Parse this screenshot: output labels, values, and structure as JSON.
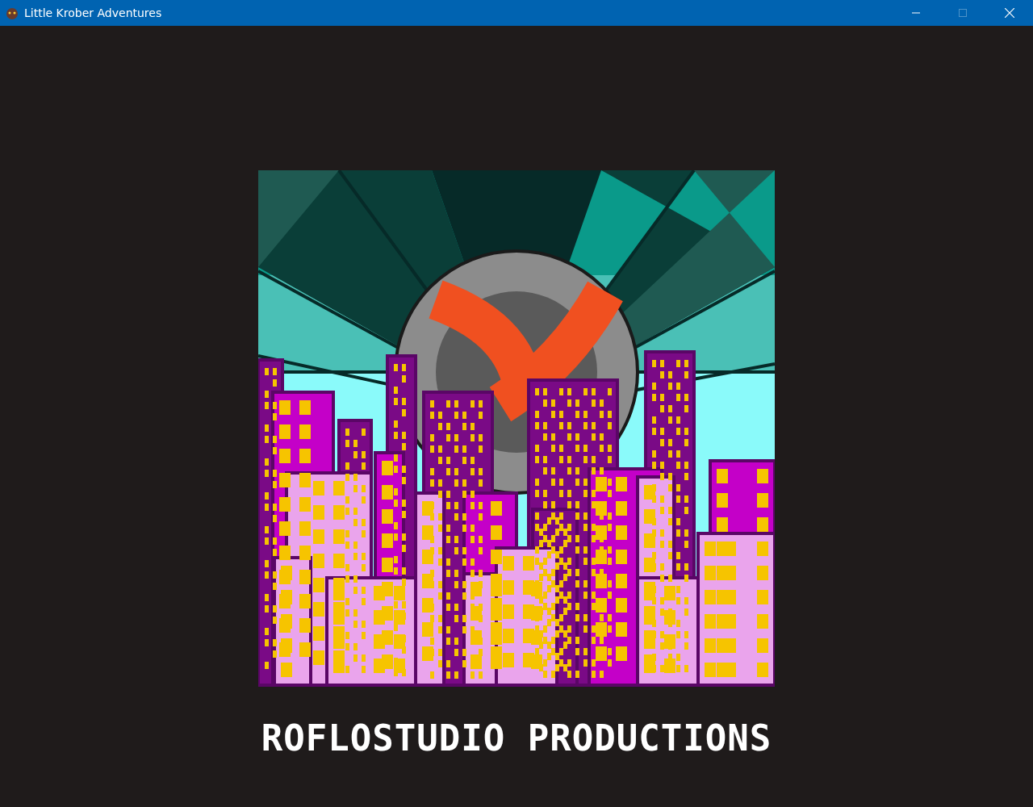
{
  "window": {
    "title": "Little Krober Adventures",
    "maximize_disabled": true
  },
  "splash": {
    "caption": "ROFLOSTUDIO PRODUCTIONS"
  }
}
